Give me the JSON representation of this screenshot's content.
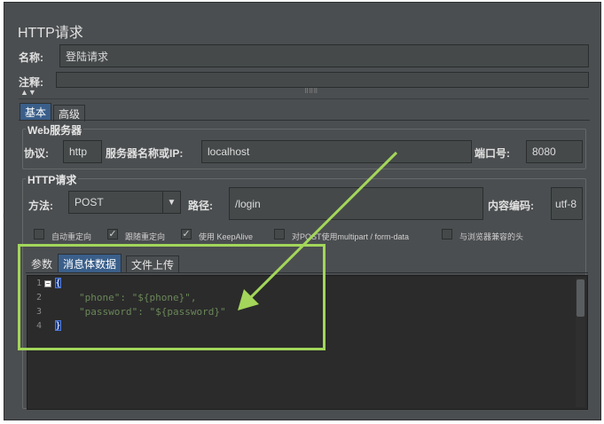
{
  "panel": {
    "title": "HTTP请求",
    "name_label": "名称:",
    "name_value": "登陆请求",
    "comment_label": "注释:",
    "comment_value": ""
  },
  "tabs": {
    "basic": "基本",
    "advanced": "高级"
  },
  "web_server": {
    "title": "Web服务器",
    "protocol_label": "协议:",
    "protocol_value": "http",
    "server_label": "服务器名称或IP:",
    "server_value": "localhost",
    "port_label": "端口号:",
    "port_value": "8080"
  },
  "http_request": {
    "title": "HTTP请求",
    "method_label": "方法:",
    "method_value": "POST",
    "path_label": "路径:",
    "path_value": "/login",
    "encoding_label": "内容编码:",
    "encoding_value": "utf-8",
    "options": [
      {
        "label": "自动重定向",
        "checked": false
      },
      {
        "label": "跟随重定向",
        "checked": true
      },
      {
        "label": "使用 KeepAlive",
        "checked": true
      },
      {
        "label": "对POST使用multipart / form-data",
        "checked": false
      },
      {
        "label": "与浏览器兼容的头",
        "checked": false
      }
    ]
  },
  "body_tabs": {
    "params": "参数",
    "body": "消息体数据",
    "upload": "文件上传"
  },
  "editor": {
    "line_numbers": [
      "1",
      "2",
      "3",
      "4"
    ],
    "open_brace": "{",
    "close_brace": "}",
    "line2": "\"phone\": \"${phone}\",",
    "line3": "\"password\": \"${password}\""
  },
  "colors": {
    "panel_bg": "#4b4e50",
    "active_tab": "#3a5f8a",
    "editor_bg": "#2b2b2b",
    "code_green": "#6a8759",
    "highlight": "#a3d65a"
  },
  "icons": {
    "fold": "minus-box-icon",
    "dropdown": "triangle-down-icon",
    "splitter": "arrow-down-icon",
    "annotation": "arrow-icon"
  }
}
